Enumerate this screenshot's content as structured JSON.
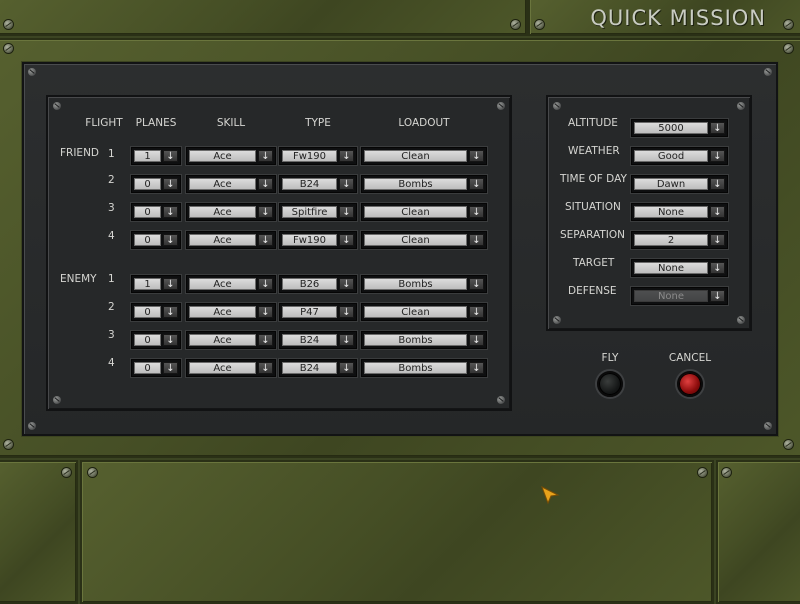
{
  "header": {
    "title": "QUICK MISSION"
  },
  "flights": {
    "headers": {
      "flight": "FLIGHT",
      "planes": "PLANES",
      "skill": "SKILL",
      "type": "TYPE",
      "loadout": "LOADOUT"
    },
    "friend": {
      "label": "FRIEND",
      "rows": [
        {
          "num": "1",
          "planes": "1",
          "skill": "Ace",
          "type": "Fw190",
          "loadout": "Clean"
        },
        {
          "num": "2",
          "planes": "0",
          "skill": "Ace",
          "type": "B24",
          "loadout": "Bombs"
        },
        {
          "num": "3",
          "planes": "0",
          "skill": "Ace",
          "type": "Spitfire",
          "loadout": "Clean"
        },
        {
          "num": "4",
          "planes": "0",
          "skill": "Ace",
          "type": "Fw190",
          "loadout": "Clean"
        }
      ]
    },
    "enemy": {
      "label": "ENEMY",
      "rows": [
        {
          "num": "1",
          "planes": "1",
          "skill": "Ace",
          "type": "B26",
          "loadout": "Bombs"
        },
        {
          "num": "2",
          "planes": "0",
          "skill": "Ace",
          "type": "P47",
          "loadout": "Clean"
        },
        {
          "num": "3",
          "planes": "0",
          "skill": "Ace",
          "type": "B24",
          "loadout": "Bombs"
        },
        {
          "num": "4",
          "planes": "0",
          "skill": "Ace",
          "type": "B24",
          "loadout": "Bombs"
        }
      ]
    }
  },
  "settings": {
    "altitude": {
      "label": "ALTITUDE",
      "value": "5000"
    },
    "weather": {
      "label": "WEATHER",
      "value": "Good"
    },
    "time_of_day": {
      "label": "TIME OF DAY",
      "value": "Dawn"
    },
    "situation": {
      "label": "SITUATION",
      "value": "None"
    },
    "separation": {
      "label": "SEPARATION",
      "value": "2"
    },
    "target": {
      "label": "TARGET",
      "value": "None"
    },
    "defense": {
      "label": "DEFENSE",
      "value": "None",
      "disabled": true
    }
  },
  "buttons": {
    "fly": "FLY",
    "cancel": "CANCEL"
  },
  "icons": {
    "dropdown": "down-arrow-icon",
    "screw": "screw-icon",
    "cursor": "arrow-cursor-icon"
  },
  "colors": {
    "accent_cursor": "#e7a21b",
    "cancel_button": "#c01818",
    "fly_button": "#101212"
  }
}
